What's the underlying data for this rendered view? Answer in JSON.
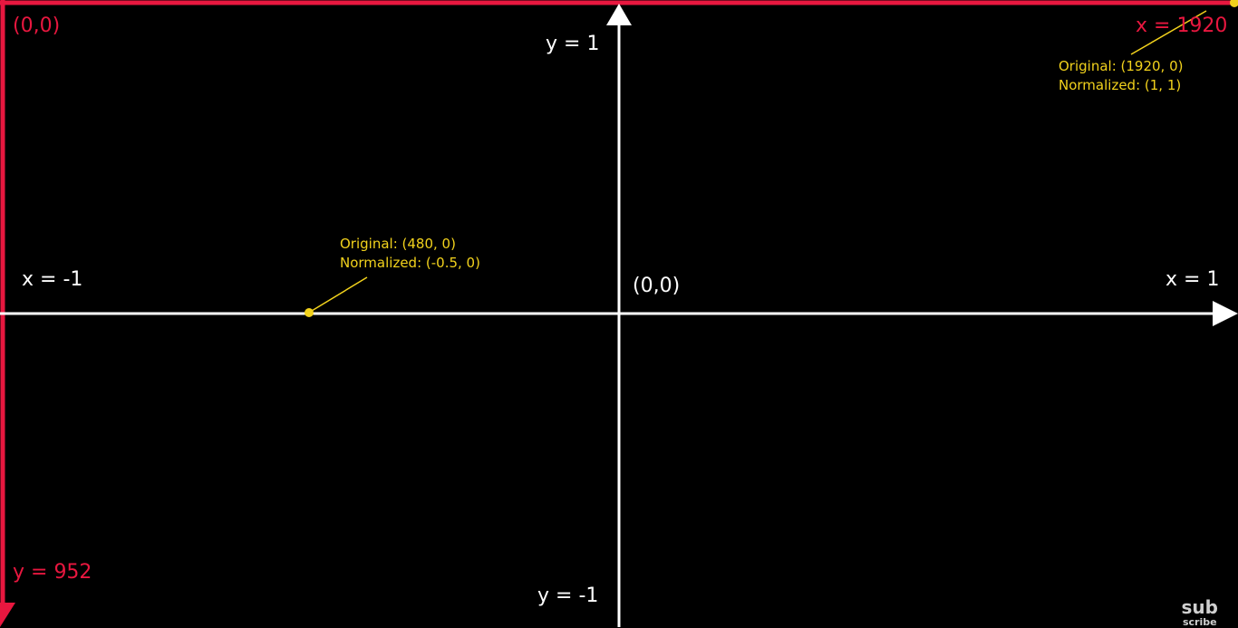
{
  "labels": {
    "pixel_origin": "(0,0)",
    "pixel_max_x": "x = 1920",
    "pixel_max_y": "y = 952",
    "y_top": "y = 1",
    "y_bottom": "y = -1",
    "x_left": "x = -1",
    "x_right": "x = 1",
    "center_origin": "(0,0)"
  },
  "annotations": {
    "corner": {
      "original": "Original: (1920, 0)",
      "normalized": "Normalized: (1, 1)"
    },
    "point": {
      "original": "Original: (480, 0)",
      "normalized": "Normalized: (-0.5, 0)"
    }
  },
  "watermark": {
    "line1": "sub",
    "line2": "scribe"
  },
  "colors": {
    "background": "#000000",
    "frame": "#e8173f",
    "axes": "#ffffff",
    "annotation": "#f2d21c"
  }
}
